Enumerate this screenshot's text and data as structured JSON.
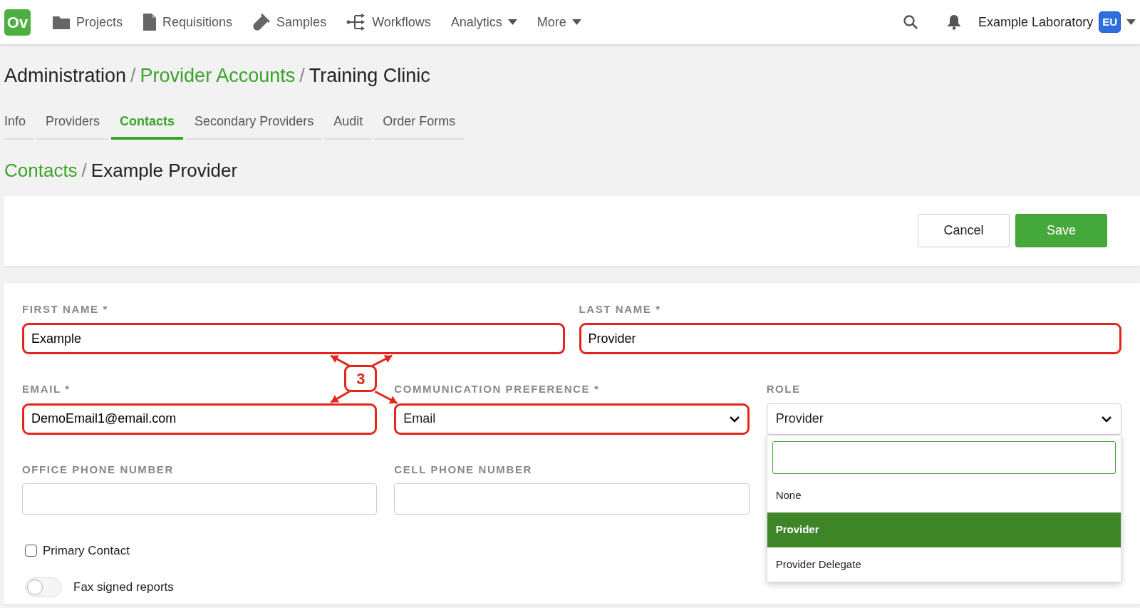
{
  "navbar": {
    "logo": "Ov",
    "items": [
      {
        "label": "Projects",
        "kind": "folder"
      },
      {
        "label": "Requisitions",
        "kind": "document"
      },
      {
        "label": "Samples",
        "kind": "tube"
      },
      {
        "label": "Workflows",
        "kind": "workflow"
      },
      {
        "label": "Analytics",
        "kind": "menu"
      },
      {
        "label": "More",
        "kind": "menu"
      }
    ],
    "lab": "Example Laboratory",
    "lab_badge": "EU"
  },
  "breadcrumb": [
    {
      "text": "Administration",
      "kind": "current"
    },
    {
      "text": "/",
      "kind": "separator"
    },
    {
      "text": "Provider Accounts",
      "kind": "link"
    },
    {
      "text": "/",
      "kind": "separator"
    },
    {
      "text": "Training Clinic",
      "kind": "current"
    }
  ],
  "tabs": [
    {
      "label": "Info",
      "selected": false
    },
    {
      "label": "Providers",
      "selected": false
    },
    {
      "label": "Contacts",
      "selected": true
    },
    {
      "label": "Secondary Providers",
      "selected": false
    },
    {
      "label": "Audit",
      "selected": false
    },
    {
      "label": "Order Forms",
      "selected": false
    }
  ],
  "sub_breadcrumb": [
    {
      "text": "Contacts",
      "kind": "link"
    },
    {
      "text": "/",
      "kind": "separator"
    },
    {
      "text": "Example Provider",
      "kind": "current"
    }
  ],
  "buttons": [
    {
      "label": "Cancel",
      "kind": "secondary"
    },
    {
      "label": "Save",
      "kind": "primary"
    }
  ],
  "form": {
    "rows": [
      [
        {
          "label": "FIRST NAME *",
          "kind": "input",
          "value": "Example",
          "highlighted": true
        },
        {
          "label": "LAST NAME *",
          "kind": "input",
          "value": "Provider",
          "highlighted": true
        }
      ],
      [
        {
          "label": "EMAIL *",
          "kind": "input",
          "value": "DemoEmail1@email.com",
          "highlighted": true
        },
        {
          "label": "COMMUNICATION PREFERENCE *",
          "kind": "select",
          "value": "Email",
          "highlighted": true
        },
        {
          "label": "ROLE",
          "kind": "select",
          "value": "Provider",
          "highlighted": false,
          "expanded": true,
          "options": [
            {
              "label": "None",
              "selected": false
            },
            {
              "label": "Provider",
              "selected": true
            },
            {
              "label": "Provider Delegate",
              "selected": false
            }
          ]
        }
      ],
      [
        {
          "label": "OFFICE PHONE NUMBER",
          "kind": "input",
          "highlighted": false
        },
        {
          "label": "CELL PHONE NUMBER",
          "kind": "input",
          "highlighted": false
        },
        {
          "kind": "spacer"
        }
      ]
    ],
    "checkbox": {
      "label": "Primary Contact",
      "checked": false
    },
    "toggle": {
      "label": "Fax signed reports",
      "on": false
    }
  },
  "annotation": {
    "label": "3"
  }
}
